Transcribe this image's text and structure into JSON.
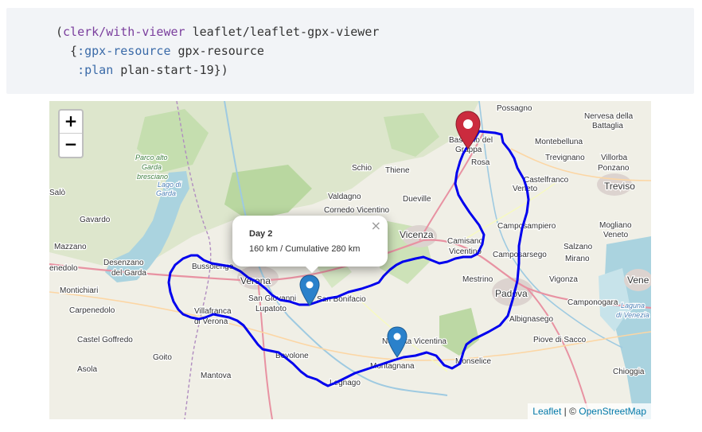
{
  "code": {
    "line1_open": "(",
    "line1_fn": "clerk/with-viewer",
    "line1_rest": " leaflet/leaflet-gpx-viewer",
    "line2_indent": "  {",
    "line2_key": ":gpx-resource",
    "line2_val": " gpx-resource",
    "line3_indent": "   ",
    "line3_key": ":plan",
    "line3_val": " plan-start-19})"
  },
  "map": {
    "zoom_in_label": "+",
    "zoom_out_label": "−",
    "popup": {
      "title": "Day 2",
      "body": "160 km / Cumulative 280 km",
      "close_label": "×"
    },
    "attribution": {
      "leaflet": "Leaflet",
      "separator": " | © ",
      "osm": "OpenStreetMap"
    },
    "route_color": "#0000ee",
    "marker_colors": {
      "start": "#cb2b3e",
      "waypoint": "#2a81cb"
    },
    "places": [
      {
        "id": "possagno",
        "name": "Possagno"
      },
      {
        "id": "nervesa",
        "name": "Nervesa della"
      },
      {
        "id": "battaglia",
        "name": "Battaglia"
      },
      {
        "id": "bassano",
        "name": "Bassano del"
      },
      {
        "id": "grappa",
        "name": "Grappa"
      },
      {
        "id": "montebelluna",
        "name": "Montebelluna"
      },
      {
        "id": "rosa",
        "name": "Rosa"
      },
      {
        "id": "trevignano",
        "name": "Trevignano"
      },
      {
        "id": "villorba",
        "name": "Villorba"
      },
      {
        "id": "ponzano",
        "name": "Ponzano"
      },
      {
        "id": "castelfranco",
        "name": "Castelfranco"
      },
      {
        "id": "veneto",
        "name": "Veneto"
      },
      {
        "id": "treviso",
        "name": "Treviso"
      },
      {
        "id": "schio",
        "name": "Schio"
      },
      {
        "id": "thiene",
        "name": "Thiene"
      },
      {
        "id": "dueville",
        "name": "Dueville"
      },
      {
        "id": "valdagno",
        "name": "Valdagno"
      },
      {
        "id": "cornedo",
        "name": "Cornedo Vicentino"
      },
      {
        "id": "vicenza",
        "name": "Vicenza"
      },
      {
        "id": "camposampiero",
        "name": "Camposampiero"
      },
      {
        "id": "mogliano",
        "name": "Mogliano"
      },
      {
        "id": "veneto2",
        "name": "Veneto"
      },
      {
        "id": "camisano",
        "name": "Camisano"
      },
      {
        "id": "vicentino",
        "name": "Vicentino"
      },
      {
        "id": "camposarsego",
        "name": "Camposarsego"
      },
      {
        "id": "salzano",
        "name": "Salzano"
      },
      {
        "id": "mirano",
        "name": "Mirano"
      },
      {
        "id": "mestrino",
        "name": "Mestrino"
      },
      {
        "id": "vigonza",
        "name": "Vigonza"
      },
      {
        "id": "venezia",
        "name": "Vene"
      },
      {
        "id": "padova",
        "name": "Padova"
      },
      {
        "id": "camponogara",
        "name": "Camponogara"
      },
      {
        "id": "albignasego",
        "name": "Albignasego"
      },
      {
        "id": "laguna",
        "name": "Laguna"
      },
      {
        "id": "divenezia",
        "name": "di Venezia"
      },
      {
        "id": "noventa",
        "name": "Noventa Vicentina"
      },
      {
        "id": "piove",
        "name": "Piove di Sacco"
      },
      {
        "id": "montagnana",
        "name": "Montagnana"
      },
      {
        "id": "monselice",
        "name": "Monselice"
      },
      {
        "id": "chioggia",
        "name": "Chioggia"
      },
      {
        "id": "legnago",
        "name": "Legnago"
      },
      {
        "id": "bovolone",
        "name": "Bovolone"
      },
      {
        "id": "verona",
        "name": "Verona"
      },
      {
        "id": "sangiovanni",
        "name": "San Giovanni"
      },
      {
        "id": "lupatoto",
        "name": "Lupatoto"
      },
      {
        "id": "sanbonifacio",
        "name": "San Bonifacio"
      },
      {
        "id": "bussolengo",
        "name": "Bussolengo"
      },
      {
        "id": "villafranca",
        "name": "Villafranca"
      },
      {
        "id": "diverona",
        "name": "di Verona"
      },
      {
        "id": "desenzano",
        "name": "Desenzano"
      },
      {
        "id": "delgarda",
        "name": "del Garda"
      },
      {
        "id": "enedolo",
        "name": "enedolo"
      },
      {
        "id": "montichiari",
        "name": "Montichiari"
      },
      {
        "id": "carpenedolo",
        "name": "Carpenedolo"
      },
      {
        "id": "castelgoffredo",
        "name": "Castel Goffredo"
      },
      {
        "id": "goito",
        "name": "Goito"
      },
      {
        "id": "mantova",
        "name": "Mantova"
      },
      {
        "id": "asola",
        "name": "Asola"
      },
      {
        "id": "mazzano",
        "name": "Mazzano"
      },
      {
        "id": "gavardo",
        "name": "Gavardo"
      },
      {
        "id": "salo",
        "name": "Salò"
      },
      {
        "id": "parco1",
        "name": "Parco alto"
      },
      {
        "id": "parco2",
        "name": "Garda"
      },
      {
        "id": "parco3",
        "name": "bresciano"
      },
      {
        "id": "lago1",
        "name": "Lago di"
      },
      {
        "id": "lago2",
        "name": "Garda"
      }
    ]
  }
}
